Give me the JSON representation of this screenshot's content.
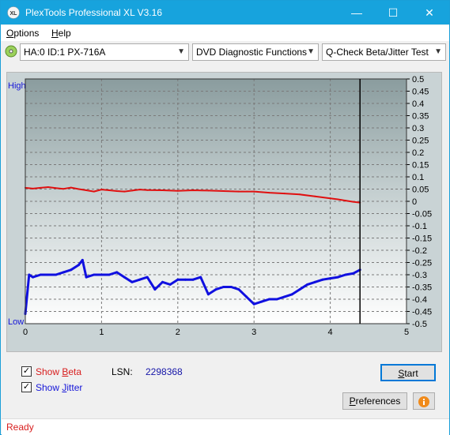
{
  "window": {
    "title": "PlexTools Professional XL V3.16",
    "controls": {
      "minimize": "—",
      "maximize": "☐",
      "close": "✕"
    }
  },
  "menu": {
    "options_accel": "O",
    "options_rest": "ptions",
    "help_accel": "H",
    "help_rest": "elp"
  },
  "toolbar": {
    "drive": "HA:0 ID:1  PX-716A",
    "function": "DVD Diagnostic Functions",
    "test": "Q-Check Beta/Jitter Test"
  },
  "chart_data": {
    "type": "line",
    "left_axis": {
      "top_label": "High",
      "bottom_label": "Low"
    },
    "x_ticks": [
      "0",
      "1",
      "2",
      "3",
      "4",
      "5"
    ],
    "xlim": [
      0,
      5
    ],
    "y_ticks": [
      "0.5",
      "0.45",
      "0.4",
      "0.35",
      "0.3",
      "0.25",
      "0.2",
      "0.15",
      "0.1",
      "0.05",
      "0",
      "-0.05",
      "-0.1",
      "-0.15",
      "-0.2",
      "-0.25",
      "-0.3",
      "-0.35",
      "-0.4",
      "-0.45",
      "-0.5"
    ],
    "ylim": [
      -0.5,
      0.5
    ],
    "grid": true,
    "end_marker_x": 4.39,
    "series": [
      {
        "color": "#e01010",
        "x": [
          0.0,
          0.1,
          0.2,
          0.3,
          0.4,
          0.5,
          0.6,
          0.7,
          0.8,
          0.9,
          1.0,
          1.1,
          1.2,
          1.3,
          1.4,
          1.5,
          1.6,
          1.8,
          2.0,
          2.2,
          2.4,
          2.6,
          2.8,
          3.0,
          3.2,
          3.4,
          3.6,
          3.8,
          4.0,
          4.1,
          4.2,
          4.3,
          4.39
        ],
        "y": [
          0.055,
          0.052,
          0.055,
          0.058,
          0.054,
          0.051,
          0.056,
          0.05,
          0.045,
          0.04,
          0.048,
          0.045,
          0.042,
          0.04,
          0.044,
          0.048,
          0.046,
          0.045,
          0.043,
          0.045,
          0.044,
          0.042,
          0.04,
          0.04,
          0.035,
          0.032,
          0.028,
          0.02,
          0.012,
          0.008,
          0.003,
          -0.002,
          -0.005
        ]
      },
      {
        "color": "#1010e0",
        "x": [
          0.0,
          0.05,
          0.1,
          0.2,
          0.3,
          0.4,
          0.5,
          0.6,
          0.7,
          0.75,
          0.8,
          0.9,
          1.0,
          1.1,
          1.2,
          1.3,
          1.4,
          1.5,
          1.6,
          1.7,
          1.8,
          1.9,
          2.0,
          2.1,
          2.2,
          2.3,
          2.4,
          2.5,
          2.6,
          2.7,
          2.8,
          2.9,
          3.0,
          3.1,
          3.2,
          3.3,
          3.4,
          3.5,
          3.6,
          3.7,
          3.8,
          3.9,
          4.0,
          4.1,
          4.2,
          4.3,
          4.39
        ],
        "y": [
          -0.46,
          -0.3,
          -0.31,
          -0.3,
          -0.3,
          -0.3,
          -0.29,
          -0.28,
          -0.26,
          -0.24,
          -0.31,
          -0.3,
          -0.3,
          -0.3,
          -0.29,
          -0.31,
          -0.33,
          -0.32,
          -0.31,
          -0.36,
          -0.33,
          -0.34,
          -0.32,
          -0.32,
          -0.32,
          -0.31,
          -0.38,
          -0.36,
          -0.35,
          -0.35,
          -0.36,
          -0.39,
          -0.42,
          -0.41,
          -0.4,
          -0.4,
          -0.39,
          -0.38,
          -0.36,
          -0.34,
          -0.33,
          -0.32,
          -0.315,
          -0.31,
          -0.3,
          -0.295,
          -0.28
        ]
      }
    ]
  },
  "options": {
    "show_beta": {
      "checked": true,
      "label_prefix": "Show ",
      "accel": "B",
      "label_rest": "eta",
      "color": "#d81e1e"
    },
    "show_jitter": {
      "checked": true,
      "label_prefix": "Show ",
      "accel": "J",
      "label_rest": "itter",
      "color": "#1515d8"
    },
    "lsn_label": "LSN:",
    "lsn_value": "2298368"
  },
  "buttons": {
    "start_accel": "S",
    "start_rest": "tart",
    "prefs_accel": "P",
    "prefs_rest": "references",
    "info_icon": "info-icon"
  },
  "status": "Ready"
}
